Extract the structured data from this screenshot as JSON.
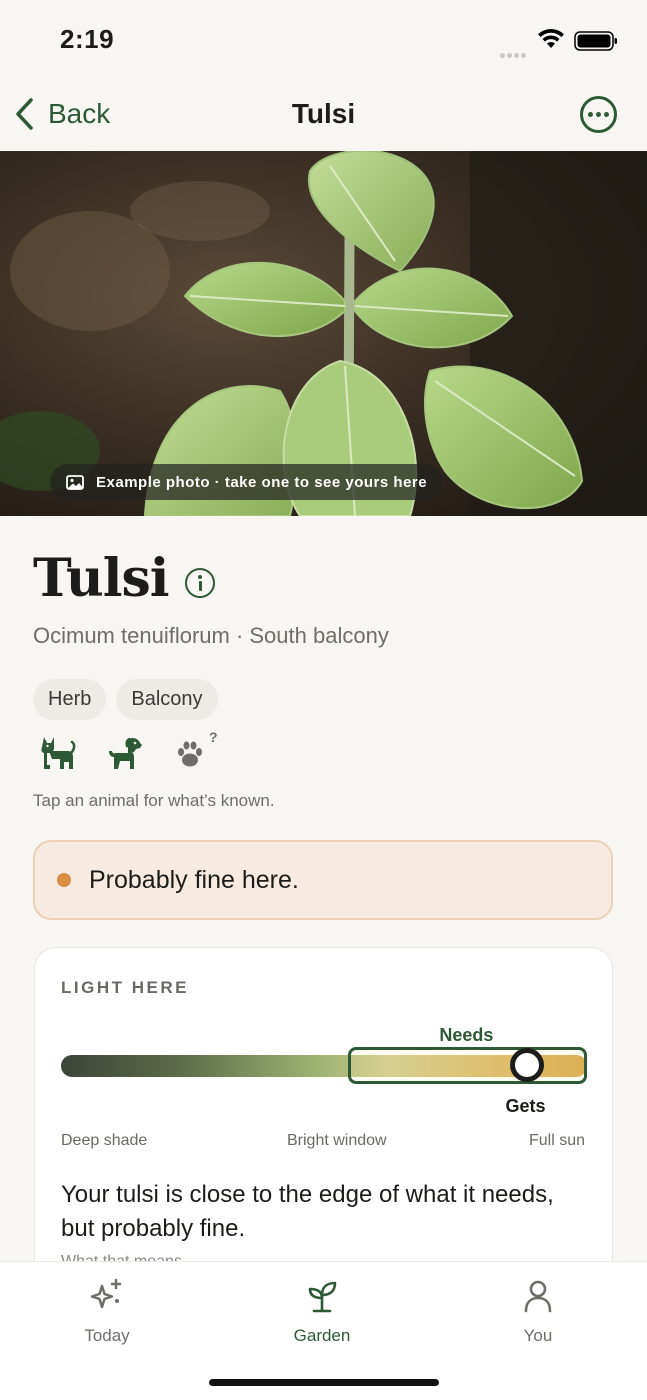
{
  "status_bar": {
    "time": "2:19"
  },
  "nav": {
    "back_label": "Back",
    "title": "Tulsi"
  },
  "hero": {
    "photo_note": "Example photo · take one to see yours here"
  },
  "plant": {
    "name": "Tulsi",
    "subtitle": "Ocimum tenuiflorum · South balcony",
    "tags": [
      "Herb",
      "Balcony"
    ],
    "pets": [
      {
        "icon": "cat-icon",
        "color": "#2d5a35"
      },
      {
        "icon": "dog-icon",
        "color": "#2d5a35"
      },
      {
        "icon": "paw-question-icon",
        "color": "#6e6e68"
      }
    ],
    "pet_hint": "Tap an animal for what’s known."
  },
  "verdict": {
    "text": "Probably fine here.",
    "color": "#d88e45"
  },
  "light_card": {
    "label": "LIGHT HERE",
    "needs_label": "Needs",
    "gets_label": "Gets",
    "scale": [
      "Deep shade",
      "Bright window",
      "Full sun"
    ],
    "needs_range": [
      0.545,
      1.0
    ],
    "gets_level": 0.885,
    "description": "Your tulsi is close to the edge of what it needs, but probably fine.",
    "sub_text_cut": "What that means"
  },
  "tabs": [
    {
      "label": "Today",
      "icon": "sparkles-icon",
      "active": false
    },
    {
      "label": "Garden",
      "icon": "sprout-icon",
      "active": true
    },
    {
      "label": "You",
      "icon": "person-icon",
      "active": false
    }
  ],
  "colors": {
    "accent": "#2d5a35",
    "background": "#f8f6f2",
    "verdict_bg": "#f7eae0"
  }
}
